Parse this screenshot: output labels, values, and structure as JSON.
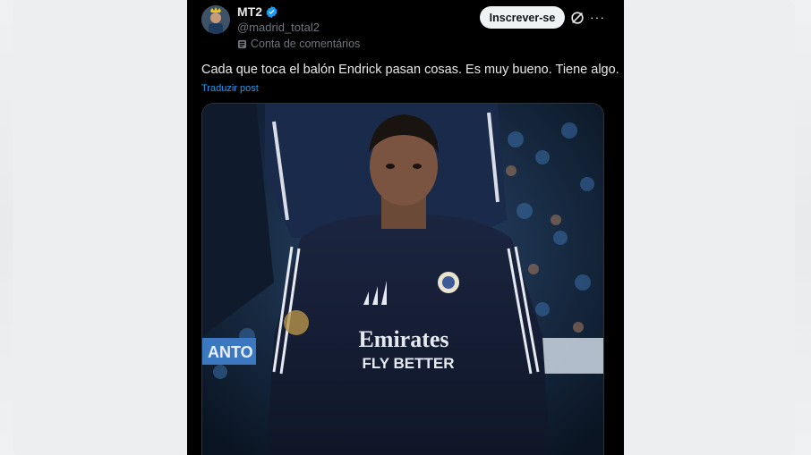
{
  "user": {
    "display_name": "MT2",
    "handle": "@madrid_total2",
    "account_label": "Conta de comentários"
  },
  "actions": {
    "subscribe_label": "Inscrever-se",
    "grok_icon": "grok-icon",
    "more_icon": "more-icon",
    "more_glyph": "···"
  },
  "post": {
    "text": "Cada que toca el balón Endrick pasan cosas. Es muy bueno. Tiene algo.",
    "translate_label": "Traduzir post"
  },
  "media": {
    "jersey_sponsor_line1": "Emirates",
    "jersey_sponsor_line2": "FLY BETTER",
    "banner_text": "ANTO"
  },
  "colors": {
    "background": "#000000",
    "text": "#e7e9ea",
    "muted": "#71767b",
    "link": "#1d9bf0",
    "verified": "#1d9bf0",
    "button_bg": "#eff3f4"
  }
}
